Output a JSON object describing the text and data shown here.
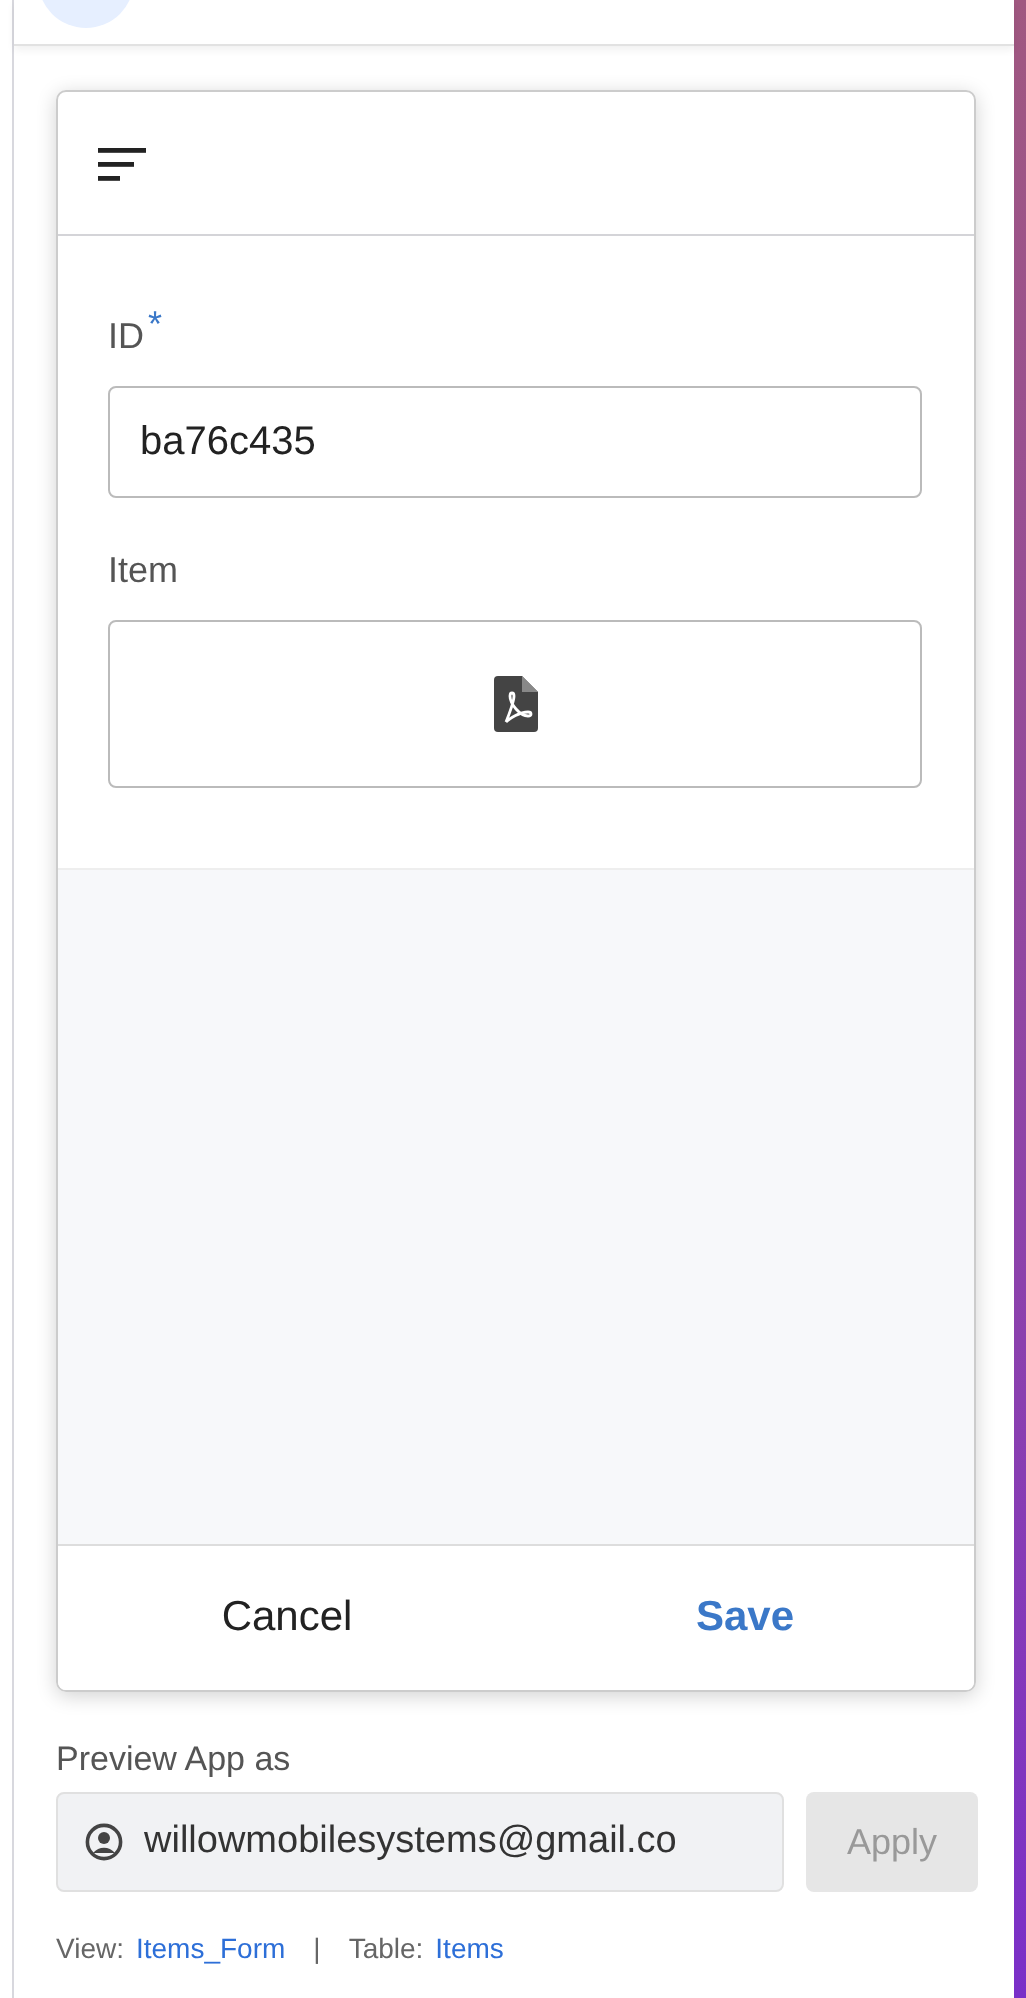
{
  "form": {
    "fields": [
      {
        "kind": "text",
        "label": "ID",
        "required_mark": "*",
        "value": "ba76c435"
      },
      {
        "kind": "file",
        "label": "Item"
      }
    ],
    "buttons": [
      {
        "label": "Cancel",
        "primary": false
      },
      {
        "label": "Save",
        "primary": true
      }
    ]
  },
  "preview": {
    "label": "Preview App as",
    "user": "willowmobilesystems@gmail.co",
    "apply": "Apply",
    "apply_disabled": true
  },
  "footer": {
    "view_label": "View:",
    "view": "Items_Form",
    "separator": "|",
    "table_label": "Table:",
    "table": "Items"
  }
}
